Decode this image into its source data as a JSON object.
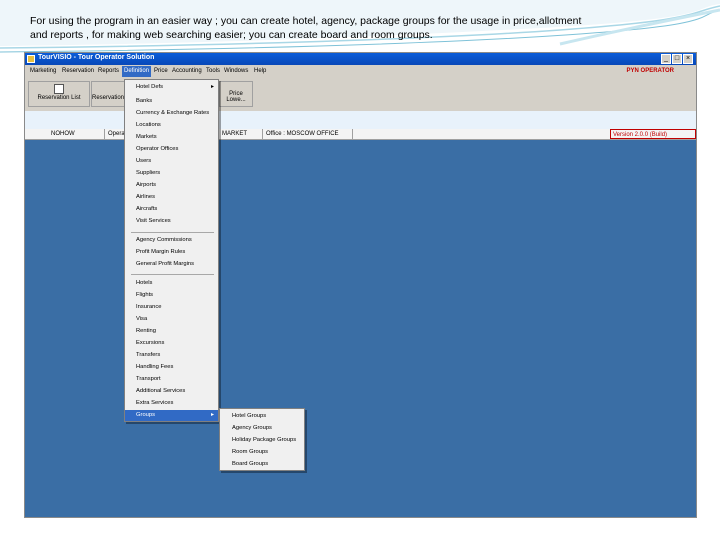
{
  "caption": "For using the program in an easier way ; you can create hotel, agency, package groups for the usage in price,allotment and reports , for making web searching easier; you can create board and room groups.",
  "window": {
    "title": "TourVISIO - Tour Operator Solution",
    "controls": [
      "_",
      "□",
      "×"
    ]
  },
  "menubar": {
    "items": [
      "Marketing",
      "Reservation",
      "Reports",
      "Definition",
      "Price",
      "Accounting",
      "Tools",
      "Windows",
      "Help"
    ],
    "user": "PYN OPERATOR"
  },
  "toolbar": {
    "buttons": [
      "Reservation List",
      "Reservation",
      "Price Lowe..."
    ]
  },
  "statusbar": {
    "cells": [
      "NOHOW",
      "Operator",
      "",
      "MARKET",
      "Office : MOSCOW OFFICE"
    ],
    "version": "Version 2.0.0 (Build)"
  },
  "definition_menu": {
    "items": [
      "Hotel Defs",
      "Banks",
      "Currency & Exchange Rates",
      "Locations",
      "Markets",
      "Operator Offices",
      "Users",
      "Suppliers",
      "Airports",
      "Airlines",
      "Aircrafts",
      "Visit Services",
      "Agency Commissions",
      "Profit Margin Rules",
      "General Profit Margins",
      "Hotels",
      "Flights",
      "Insurance",
      "Visa",
      "Renting",
      "Excursions",
      "Transfers",
      "Handling Fees",
      "Transport",
      "Additional Services",
      "Extra Services",
      "Groups"
    ],
    "selected": "Groups"
  },
  "groups_submenu": {
    "items": [
      "Hotel Groups",
      "Agency Groups",
      "Holiday Package Groups",
      "Room Groups",
      "Board Groups"
    ]
  },
  "colors": {
    "desktop": "#3a6ea5",
    "titlebar": "#0a5cd8",
    "menu_highlight": "#316ac5",
    "accent_red": "#c00000"
  }
}
